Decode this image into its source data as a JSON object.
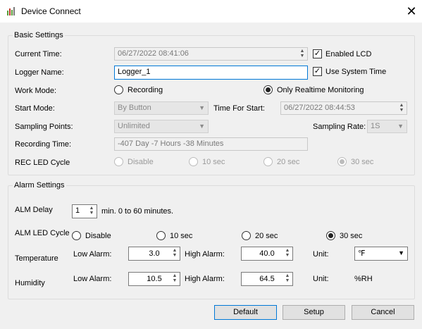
{
  "window": {
    "title": "Device Connect",
    "close_glyph": "✕",
    "icon": "app-logo-icon"
  },
  "basic": {
    "legend": "Basic Settings",
    "current_time": {
      "label": "Current Time:",
      "value": "06/27/2022 08:41:06"
    },
    "enabled_lcd": {
      "label": "Enabled LCD",
      "checked": true
    },
    "logger_name": {
      "label": "Logger Name:",
      "value": "Logger_1"
    },
    "use_system_time": {
      "label": "Use System Time",
      "checked": true
    },
    "work_mode": {
      "label": "Work Mode:",
      "opt_recording": "Recording",
      "opt_realtime": "Only Realtime Monitoring",
      "selected": "Only Realtime Monitoring"
    },
    "start_mode": {
      "label": "Start Mode:",
      "value": "By Button"
    },
    "time_for_start": {
      "label": "Time For Start:",
      "value": "06/27/2022 08:44:53"
    },
    "sampling_points": {
      "label": "Sampling Points:",
      "value": "Unlimited"
    },
    "sampling_rate": {
      "label": "Sampling Rate:",
      "value": "1S"
    },
    "recording_time": {
      "label": "Recording Time:",
      "value": "-407 Day -7 Hours -38 Minutes"
    },
    "rec_led": {
      "label": "REC LED Cycle",
      "opt1": "Disable",
      "opt2": "10 sec",
      "opt3": "20 sec",
      "opt4": "30 sec",
      "selected": "30 sec"
    }
  },
  "alarm": {
    "legend": "Alarm Settings",
    "alm_delay": {
      "label": "ALM Delay",
      "value": "1",
      "suffix": "min.  0 to 60 minutes."
    },
    "alm_led": {
      "label": "ALM LED Cycle",
      "opt1": "Disable",
      "opt2": "10 sec",
      "opt3": "20 sec",
      "opt4": "30 sec",
      "selected": "30 sec"
    },
    "temperature": {
      "label": "Temperature",
      "low_label": "Low Alarm:",
      "low": "3.0",
      "high_label": "High Alarm:",
      "high": "40.0",
      "unit_label": "Unit:",
      "unit": "℉"
    },
    "humidity": {
      "label": "Humidity",
      "low_label": "Low Alarm:",
      "low": "10.5",
      "high_label": "High Alarm:",
      "high": "64.5",
      "unit_label": "Unit:",
      "unit": "%RH"
    }
  },
  "buttons": {
    "default": "Default",
    "setup": "Setup",
    "cancel": "Cancel"
  },
  "colors": {
    "accent": "#0078d7",
    "window_bg": "#f0f0f0"
  }
}
